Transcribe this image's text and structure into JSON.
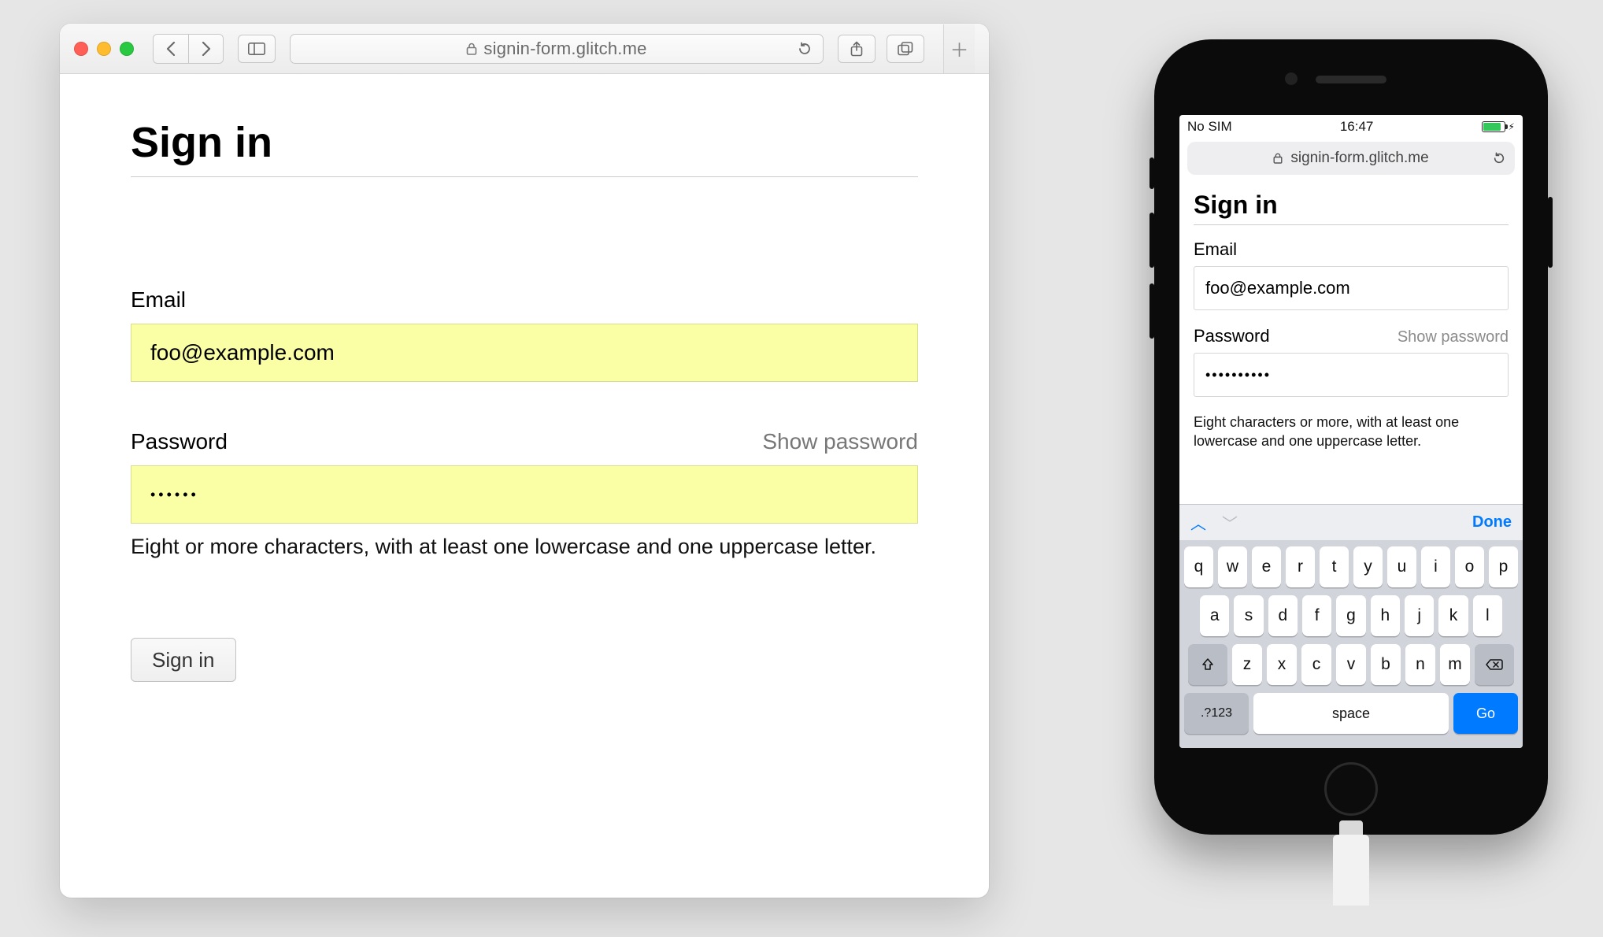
{
  "desktop": {
    "url": "signin-form.glitch.me",
    "page": {
      "title": "Sign in",
      "email_label": "Email",
      "email_value": "foo@example.com",
      "password_label": "Password",
      "show_password": "Show password",
      "password_value": "••••••",
      "password_hint": "Eight or more characters, with at least one lowercase and one uppercase letter.",
      "submit": "Sign in"
    }
  },
  "mobile": {
    "status": {
      "carrier": "No SIM",
      "time": "16:47"
    },
    "url": "signin-form.glitch.me",
    "page": {
      "title": "Sign in",
      "email_label": "Email",
      "email_value": "foo@example.com",
      "password_label": "Password",
      "show_password": "Show password",
      "password_value": "••••••••••",
      "password_hint": "Eight characters or more, with at least one lowercase and one uppercase letter."
    },
    "keyboard": {
      "done": "Done",
      "rows": [
        [
          "q",
          "w",
          "e",
          "r",
          "t",
          "y",
          "u",
          "i",
          "o",
          "p"
        ],
        [
          "a",
          "s",
          "d",
          "f",
          "g",
          "h",
          "j",
          "k",
          "l"
        ],
        [
          "z",
          "x",
          "c",
          "v",
          "b",
          "n",
          "m"
        ]
      ],
      "numbers_key": ".?123",
      "space_key": "space",
      "go_key": "Go"
    }
  }
}
